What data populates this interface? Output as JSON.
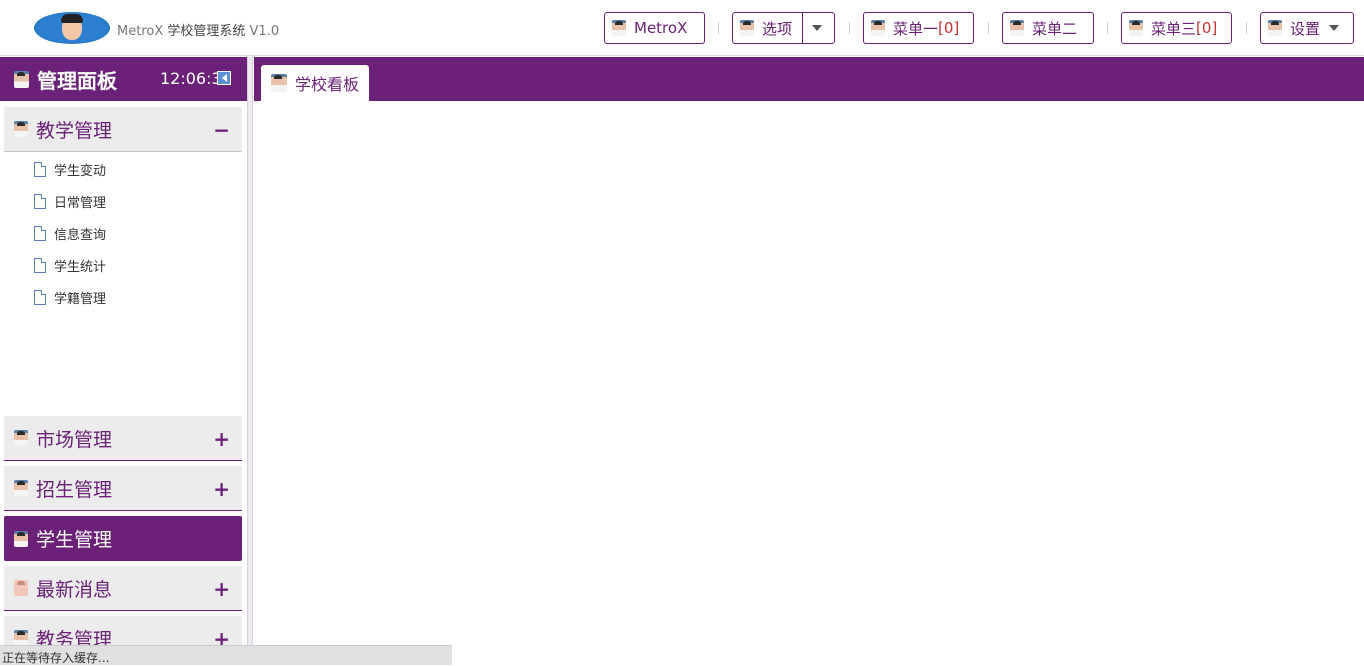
{
  "header": {
    "app_name_en": "MetroX",
    "app_name_cn": "学校管理系统",
    "version": "V1.0",
    "buttons": {
      "metrox": "MetroX",
      "options": "选项",
      "menu1": "菜单一",
      "menu1_count": "[0]",
      "menu2": "菜单二",
      "menu3": "菜单三",
      "menu3_count": "[0]",
      "settings": "设置"
    }
  },
  "sidebar": {
    "title": "管理面板",
    "clock": "12:06:32",
    "groups": [
      {
        "label": "教学管理",
        "toggle": "−",
        "expanded": true
      },
      {
        "label": "市场管理",
        "toggle": "+"
      },
      {
        "label": "招生管理",
        "toggle": "+"
      },
      {
        "label": "学生管理",
        "toggle": "",
        "active": true
      },
      {
        "label": "最新消息",
        "toggle": "+"
      },
      {
        "label": "教务管理",
        "toggle": "+"
      }
    ],
    "teaching_items": [
      "学生变动",
      "日常管理",
      "信息查询",
      "学生统计",
      "学籍管理"
    ]
  },
  "tabs": [
    {
      "label": "学校看板"
    }
  ],
  "status": "正在等待存入缓存...",
  "colors": {
    "accent": "#6b2178",
    "badge": "#c03030"
  }
}
